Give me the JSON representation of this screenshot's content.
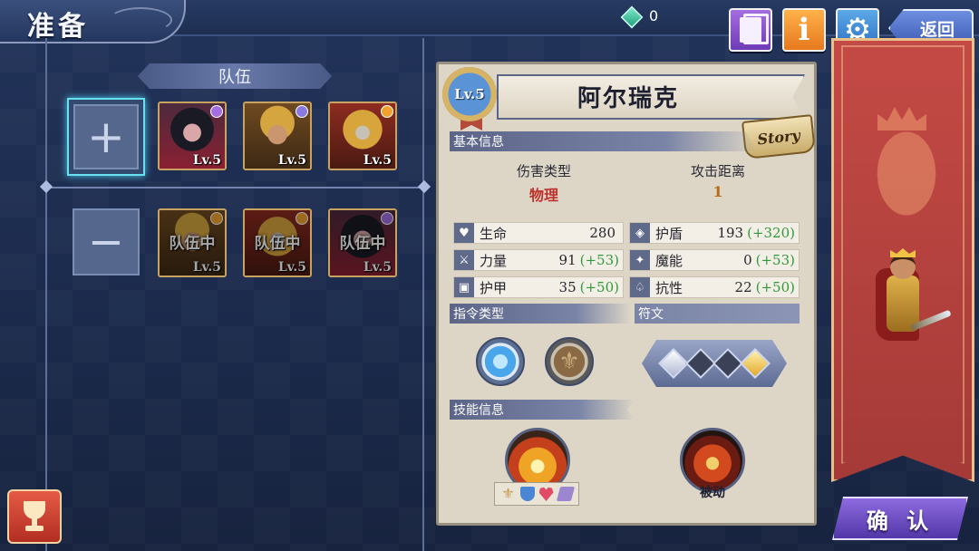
{
  "header": {
    "title": "准备",
    "gem_count": "0",
    "back_label": "返回",
    "info_glyph": "i",
    "gear_glyph": "⚙"
  },
  "team": {
    "banner": "队伍",
    "add_glyph": "+",
    "remove_glyph": "−",
    "selected": [
      {
        "name": "vampire",
        "level": "Lv.5",
        "element_color": "#a46ee0"
      },
      {
        "name": "king",
        "level": "Lv.5",
        "element_color": "#8a7ae0"
      },
      {
        "name": "helm-knight",
        "level": "Lv.5",
        "element_color": "#f0a22e"
      }
    ],
    "in_team": [
      {
        "name": "king",
        "level": "Lv.5",
        "status": "队伍中",
        "element_color": "#f0a22e"
      },
      {
        "name": "helm-knight",
        "level": "Lv.5",
        "status": "队伍中",
        "element_color": "#f0a22e"
      },
      {
        "name": "vampire",
        "level": "Lv.5",
        "status": "队伍中",
        "element_color": "#a46ee0"
      }
    ]
  },
  "hero": {
    "name": "阿尔瑞克",
    "level_badge": "Lv.5",
    "story_label": "Story",
    "basic_info_title": "基本信息",
    "damage_type_label": "伤害类型",
    "damage_type_value": "物理",
    "range_label": "攻击距离",
    "range_value": "1",
    "stats": [
      {
        "name": "生命",
        "value": "280",
        "bonus": "",
        "icon": "heart-icon",
        "glyph": "♥"
      },
      {
        "name": "护盾",
        "value": "193",
        "bonus": "(+320)",
        "icon": "shield-icon",
        "glyph": "◈"
      },
      {
        "name": "力量",
        "value": "91",
        "bonus": "(+53)",
        "icon": "sword-icon",
        "glyph": "⚔"
      },
      {
        "name": "魔能",
        "value": "0",
        "bonus": "(+53)",
        "icon": "magic-icon",
        "glyph": "✦"
      },
      {
        "name": "护甲",
        "value": "35",
        "bonus": "(+50)",
        "icon": "armor-icon",
        "glyph": "▣"
      },
      {
        "name": "抗性",
        "value": "22",
        "bonus": "(+50)",
        "icon": "resist-icon",
        "glyph": "♤"
      }
    ],
    "command_title": "指令类型",
    "rune_title": "符文",
    "skill_title": "技能信息",
    "passive_label": "被动",
    "fleur_glyph": "⚜"
  },
  "actions": {
    "confirm_label": "确 认"
  },
  "colors": {
    "accent_cyan": "#69e0f0",
    "bonus_green": "#2f9a3a",
    "damage_red": "#c0302a",
    "banner_red": "#c44a45"
  }
}
